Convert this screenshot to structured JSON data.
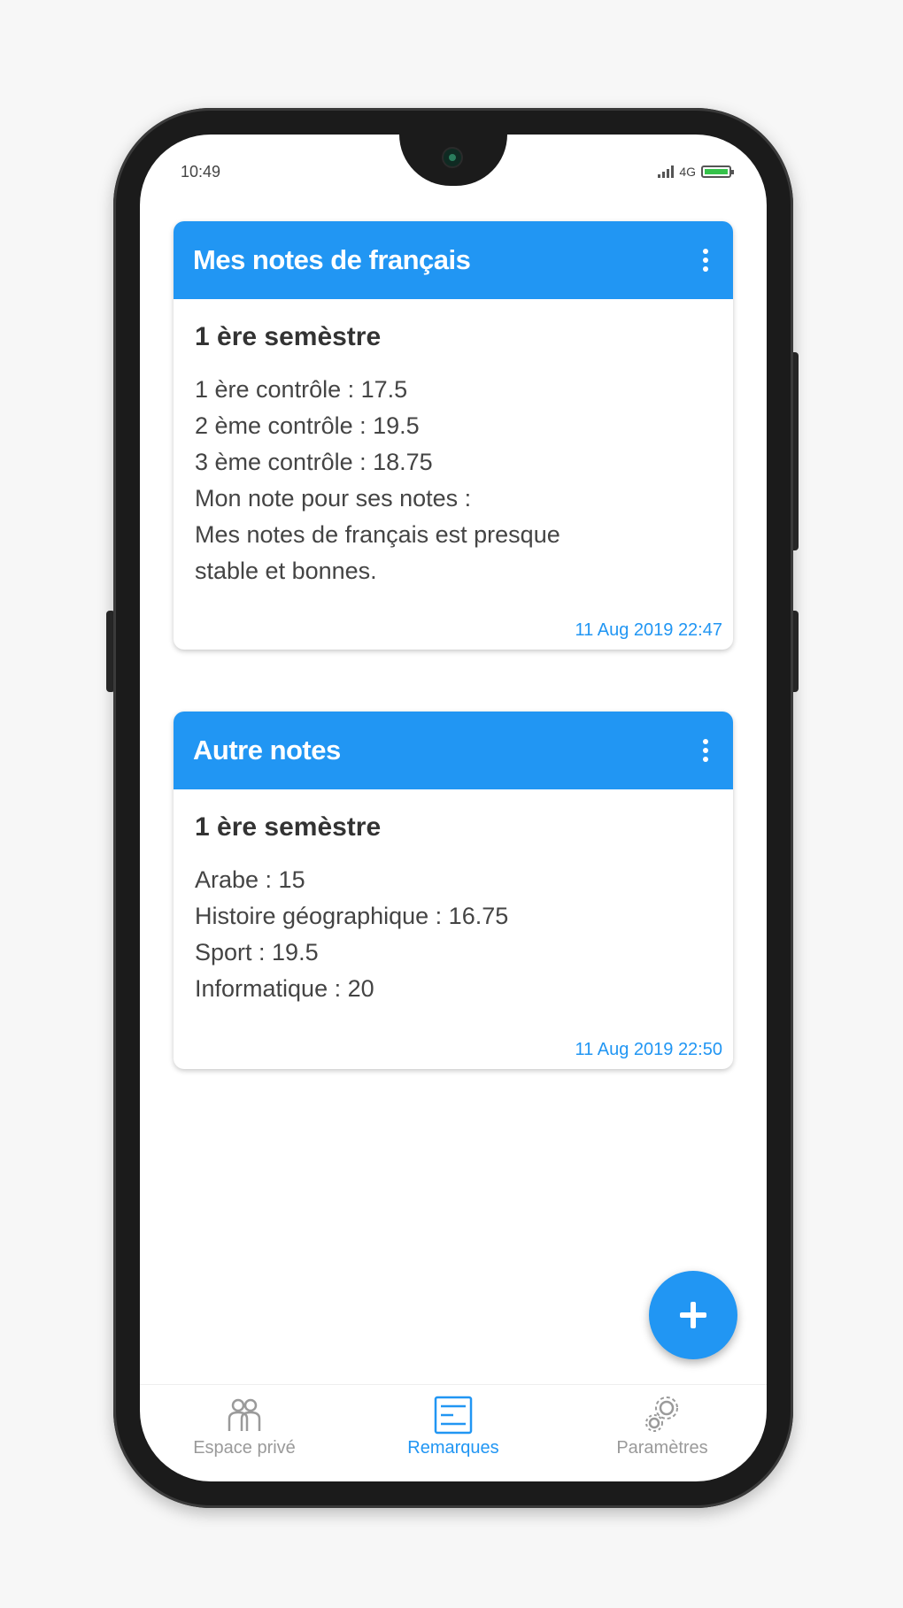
{
  "status_bar": {
    "time": "10:49",
    "network": "4G"
  },
  "notes": [
    {
      "title": "Mes notes de français",
      "subtitle": "1 ère semèstre",
      "lines": [
        "1 ère contrôle : 17.5",
        "2 ème contrôle : 19.5",
        "3 ème contrôle : 18.75",
        "Mon note pour ses notes :",
        "Mes notes de français est presque",
        "stable et bonnes."
      ],
      "date": "11 Aug 2019 22:47"
    },
    {
      "title": "Autre notes",
      "subtitle": "1 ère semèstre",
      "lines": [
        "Arabe : 15",
        "Histoire géographique : 16.75",
        "Sport : 19.5",
        "Informatique : 20"
      ],
      "date": "11 Aug 2019 22:50"
    }
  ],
  "fab": {
    "icon": "plus-icon"
  },
  "bottom_nav": {
    "items": [
      {
        "label": "Espace privé",
        "icon": "people-icon",
        "active": false
      },
      {
        "label": "Remarques",
        "icon": "notes-list-icon",
        "active": true
      },
      {
        "label": "Paramètres",
        "icon": "settings-icon",
        "active": false
      }
    ]
  },
  "colors": {
    "primary": "#2196f3",
    "card_text": "#444444",
    "nav_inactive": "#9a9a9a"
  }
}
